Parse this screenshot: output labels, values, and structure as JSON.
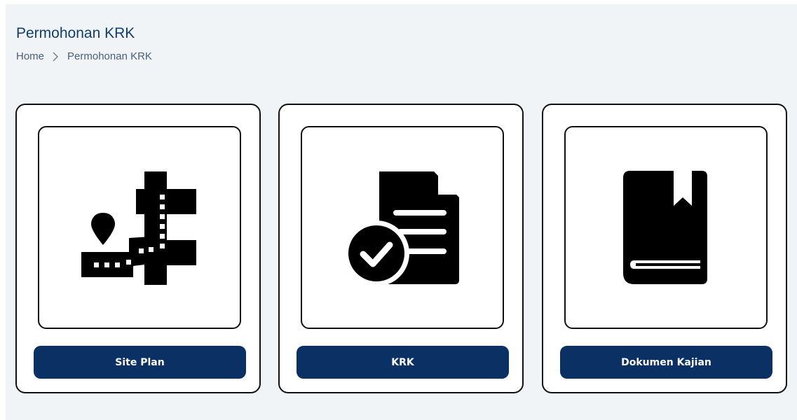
{
  "header": {
    "title": "Permohonan KRK"
  },
  "breadcrumb": {
    "home": "Home",
    "current": "Permohonan KRK"
  },
  "cards": [
    {
      "icon": "map-route-icon",
      "button_label": "Site Plan"
    },
    {
      "icon": "document-check-icon",
      "button_label": "KRK"
    },
    {
      "icon": "book-bookmark-icon",
      "button_label": "Dokumen Kajian"
    }
  ],
  "colors": {
    "background": "#f0f4f7",
    "title": "#123e6e",
    "button": "#0b3164",
    "icon": "#000000"
  }
}
